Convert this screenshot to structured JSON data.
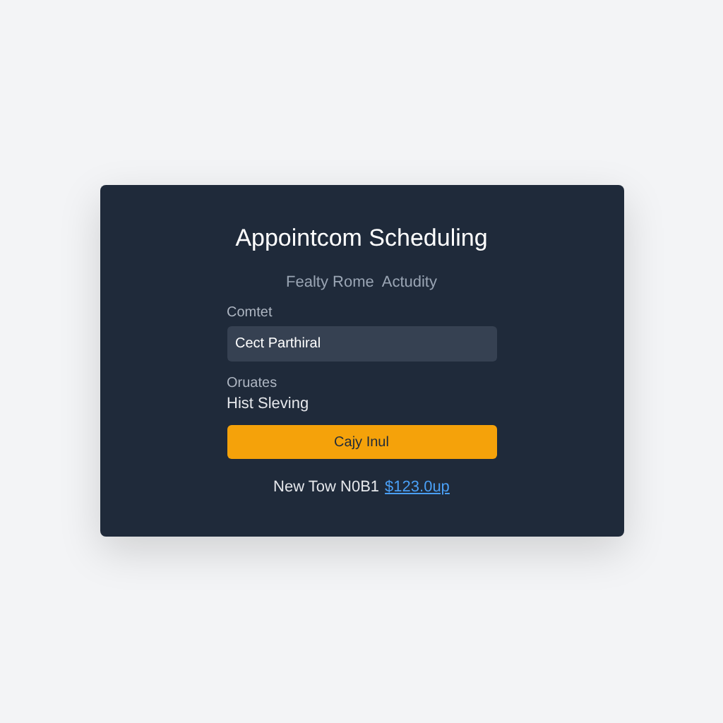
{
  "card": {
    "title": "Appointcom Scheduling",
    "subtitle": "Fealty Rome  Actudity",
    "field": {
      "label": "Comtet",
      "value": "Cect Parthiral"
    },
    "info": {
      "label": "Oruates",
      "value": "Hist Sleving"
    },
    "button": "Cajy Inul",
    "footer": {
      "text": "New Tow N0B1",
      "link": "$123.0up"
    }
  }
}
